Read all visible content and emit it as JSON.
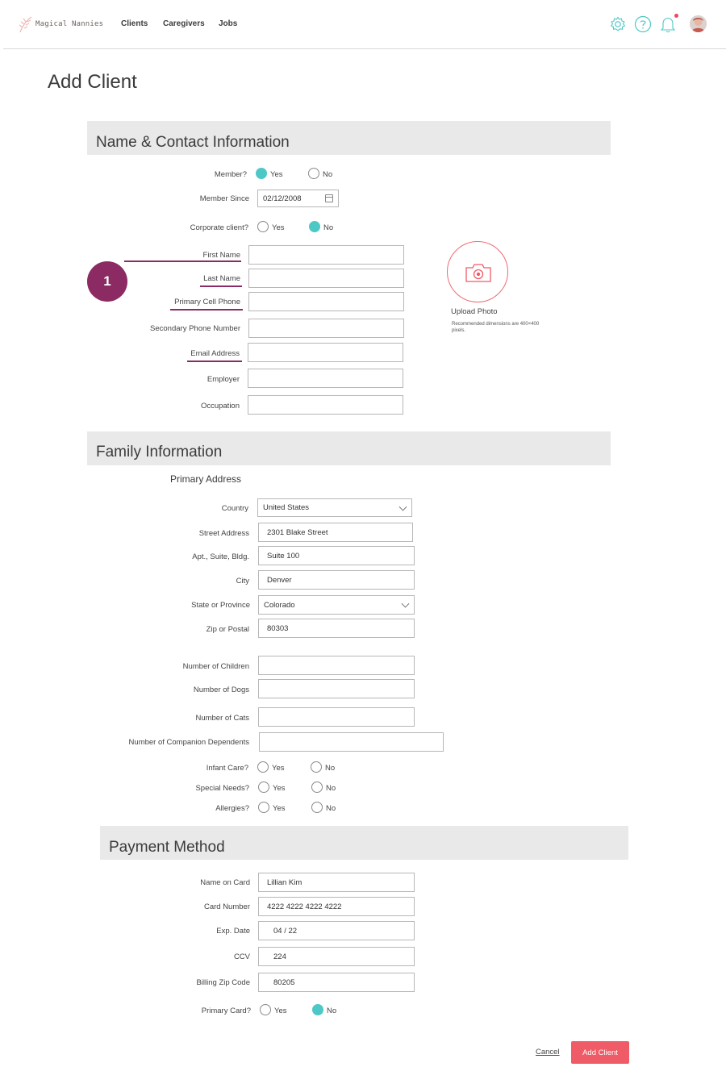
{
  "nav": {
    "brand": "Magical Nannies",
    "links": [
      "Clients",
      "Caregivers",
      "Jobs"
    ],
    "icons": [
      "gear-icon",
      "help-icon",
      "bell-icon",
      "avatar"
    ]
  },
  "page_title": "Add Client",
  "badge": "1",
  "contact": {
    "title": "Name & Contact Information",
    "member_label": "Member?",
    "member_since_label": "Member Since",
    "member_since_value": "02/12/2008",
    "corporate_label": "Corporate client?",
    "yes": "Yes",
    "no": "No",
    "first_name": "First Name",
    "last_name": "Last Name",
    "primary_phone": "Primary Cell Phone",
    "secondary_phone": "Secondary Phone Number",
    "email": "Email Address",
    "employer": "Employer",
    "occupation": "Occupation",
    "upload_label": "Upload Photo",
    "upload_note": "Recommended dimensions are 400×400 pixels."
  },
  "family": {
    "title": "Family Information",
    "subhead": "Primary Address",
    "country_label": "Country",
    "country_value": "United States",
    "street_label": "Street Address",
    "street_value": "2301 Blake Street",
    "apt_label": "Apt., Suite, Bldg.",
    "apt_value": "Suite 100",
    "city_label": "City",
    "city_value": "Denver",
    "state_label": "State or Province",
    "state_value": "Colorado",
    "zip_label": "Zip or Postal",
    "zip_value": "80303",
    "children_label": "Number of Children",
    "dogs_label": "Number of Dogs",
    "cats_label": "Number of Cats",
    "companion_label": "Number of Companion Dependents",
    "infant_label": "Infant Care?",
    "special_label": "Special Needs?",
    "allergies_label": "Allergies?",
    "yes": "Yes",
    "no": "No"
  },
  "payment": {
    "title": "Payment Method",
    "name_label": "Name on Card",
    "name_value": "Lillian Kim",
    "card_label": "Card Number",
    "card_value": "4222 4222 4222 4222",
    "exp_label": "Exp. Date",
    "exp_value": "04 / 22",
    "ccv_label": "CCV",
    "ccv_value": "224",
    "zip_label": "Billing Zip Code",
    "zip_value": "80205",
    "primary_label": "Primary Card?",
    "yes": "Yes",
    "no": "No"
  },
  "actions": {
    "cancel": "Cancel",
    "submit": "Add Client"
  },
  "colors": {
    "accent_teal": "#4ec8c7",
    "accent_plum": "#8b2a63",
    "button_red": "#ef5b66"
  }
}
